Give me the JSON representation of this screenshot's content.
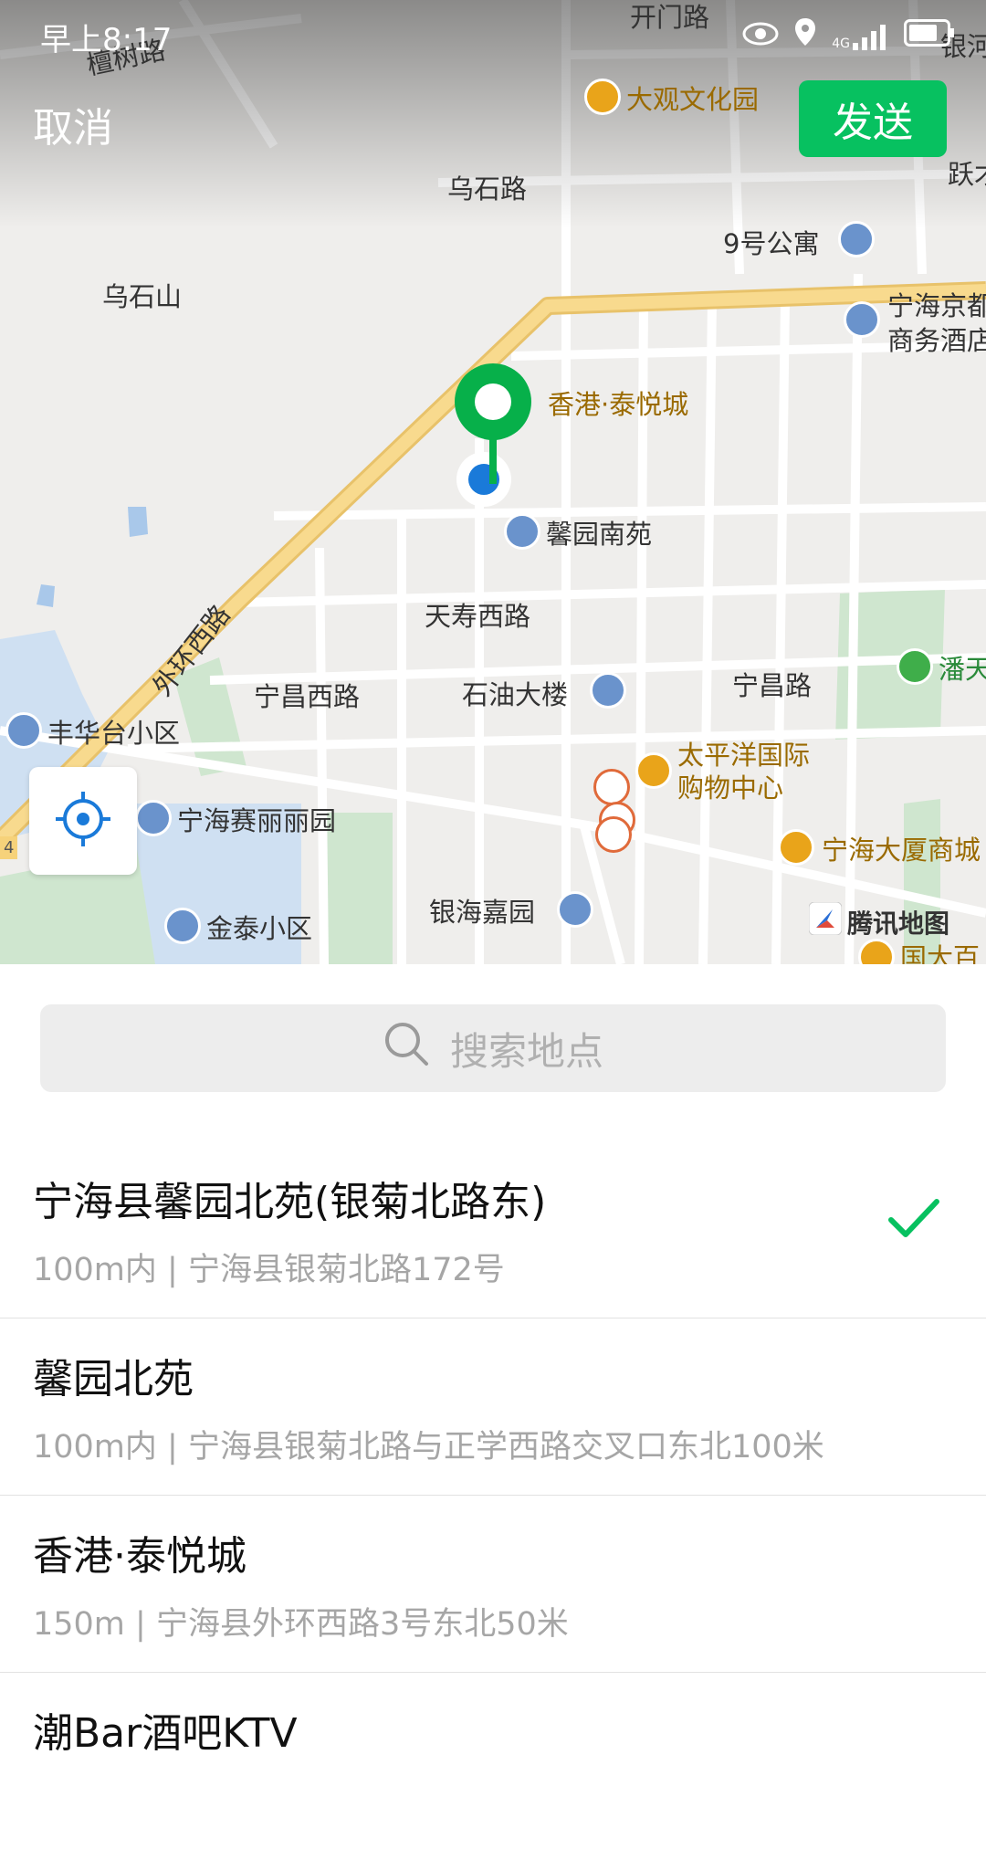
{
  "status_bar": {
    "time": "早上8:17",
    "network": "4G"
  },
  "header": {
    "cancel_label": "取消",
    "send_label": "发送"
  },
  "map": {
    "roads": [
      {
        "label": "檀树路"
      },
      {
        "label": "乌石路"
      },
      {
        "label": "天寿西路"
      },
      {
        "label": "宁昌西路"
      },
      {
        "label": "宁昌路"
      },
      {
        "label": "外环西路"
      }
    ],
    "places": [
      {
        "label": "乌石山",
        "kind": "area"
      },
      {
        "label": "大观文化园",
        "kind": "orange"
      },
      {
        "label": "9号公寓",
        "kind": "blue"
      },
      {
        "label": "宁海京都",
        "kind": "blue"
      },
      {
        "label": "商务酒店",
        "kind": "blue"
      },
      {
        "label": "香港·泰悦城",
        "kind": "orange"
      },
      {
        "label": "馨园南苑",
        "kind": "blue"
      },
      {
        "label": "石油大楼",
        "kind": "blue"
      },
      {
        "label": "潘天",
        "kind": "green"
      },
      {
        "label": "丰华台小区",
        "kind": "blue"
      },
      {
        "label": "太平洋国际",
        "kind": "orange"
      },
      {
        "label": "购物中心",
        "kind": "orange"
      },
      {
        "label": "宁海赛丽丽园",
        "kind": "blue"
      },
      {
        "label": "宁海大厦商城",
        "kind": "orange"
      },
      {
        "label": "银海嘉园",
        "kind": "blue"
      },
      {
        "label": "金泰小区",
        "kind": "blue"
      },
      {
        "label": "国大百",
        "kind": "orange"
      },
      {
        "label": "跃才",
        "kind": "plain"
      },
      {
        "label": "银河",
        "kind": "plain"
      },
      {
        "label": "开门路",
        "kind": "plain"
      }
    ],
    "attribution": "腾讯地图",
    "edge_marker": "4"
  },
  "search": {
    "placeholder": "搜索地点"
  },
  "results": [
    {
      "name": "宁海县馨园北苑(银菊北路东)",
      "address": "100m内 | 宁海县银菊北路172号",
      "selected": true
    },
    {
      "name": "馨园北苑",
      "address": "100m内 | 宁海县银菊北路与正学西路交叉口东北100米",
      "selected": false
    },
    {
      "name": "香港·泰悦城",
      "address": "150m | 宁海县外环西路3号东北50米",
      "selected": false
    },
    {
      "name": "潮Bar酒吧KTV",
      "address": "",
      "selected": false
    }
  ],
  "colors": {
    "accent": "#07c160",
    "locate_blue": "#1a7ad9",
    "highway": "#f6d27a"
  }
}
